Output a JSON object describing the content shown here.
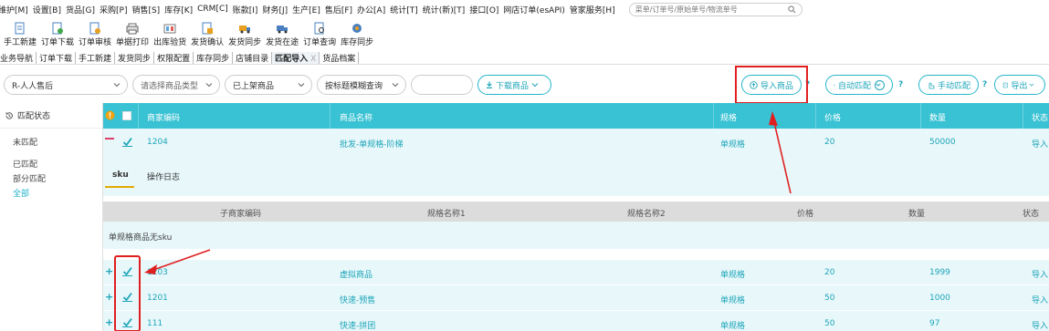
{
  "menu": [
    "维护[M]",
    "设置[B]",
    "货品[G]",
    "采购[P]",
    "销售[S]",
    "库存[K]",
    "CRM[C]",
    "账款[I]",
    "财务[J]",
    "生产[E]",
    "售后[F]",
    "办公[A]",
    "统计[T]",
    "统计(新)[T]",
    "接口[O]",
    "网店订单(esAPI)",
    "管家服务[H]"
  ],
  "search": {
    "placeholder": "菜单/订单号/原始单号/物流单号"
  },
  "toolbar": [
    "手工新建",
    "订单下载",
    "订单审核",
    "单据打印",
    "出库验货",
    "发货确认",
    "发货同步",
    "发货在途",
    "订单查询",
    "库存同步"
  ],
  "tabs": [
    "业务导航",
    "订单下载",
    "手工新建",
    "发货同步",
    "权限配置",
    "库存同步",
    "店铺目录",
    "匹配导入",
    "货品档案"
  ],
  "active_tab": "匹配导入",
  "tab_close": "X",
  "filters": {
    "shop": "R-人人售后",
    "category_placeholder": "请选择商品类型",
    "status": "已上架商品",
    "query_mode": "按标题模糊查询",
    "keyword": ""
  },
  "buttons": {
    "download_goods": "下载商品",
    "import_goods": "导入商品",
    "auto_match": "自动匹配",
    "manual_match": "手动匹配",
    "export": "导出",
    "help": "?"
  },
  "sidebar": {
    "title": "匹配状态",
    "items": [
      "未匹配",
      "已匹配",
      "部分匹配",
      "全部"
    ]
  },
  "table": {
    "headers": [
      "商家编码",
      "商品名称",
      "规格",
      "价格",
      "数量",
      "状态"
    ],
    "parent": {
      "code": "1204",
      "name": "批发-单规格-阶梯",
      "spec": "单规格",
      "price": "20",
      "qty": "50000",
      "status": "导入"
    },
    "subtabs": [
      "sku",
      "操作日志"
    ],
    "sub_headers": [
      "子商家编码",
      "规格名称1",
      "规格名称2",
      "价格",
      "数量",
      "状态"
    ],
    "no_sku_text": "单规格商品无sku",
    "rows": [
      {
        "code": "1203",
        "name": "虚拟商品",
        "spec": "单规格",
        "price": "20",
        "qty": "1999",
        "status": "导入"
      },
      {
        "code": "1201",
        "name": "快速-预售",
        "spec": "单规格",
        "price": "50",
        "qty": "1000",
        "status": "导入"
      },
      {
        "code": "111",
        "name": "快速-拼团",
        "spec": "单规格",
        "price": "50",
        "qty": "97",
        "status": "导入"
      }
    ]
  },
  "colors": {
    "accent": "#38c2d3",
    "link": "#1fa6ba",
    "highlight": "#e02020"
  }
}
